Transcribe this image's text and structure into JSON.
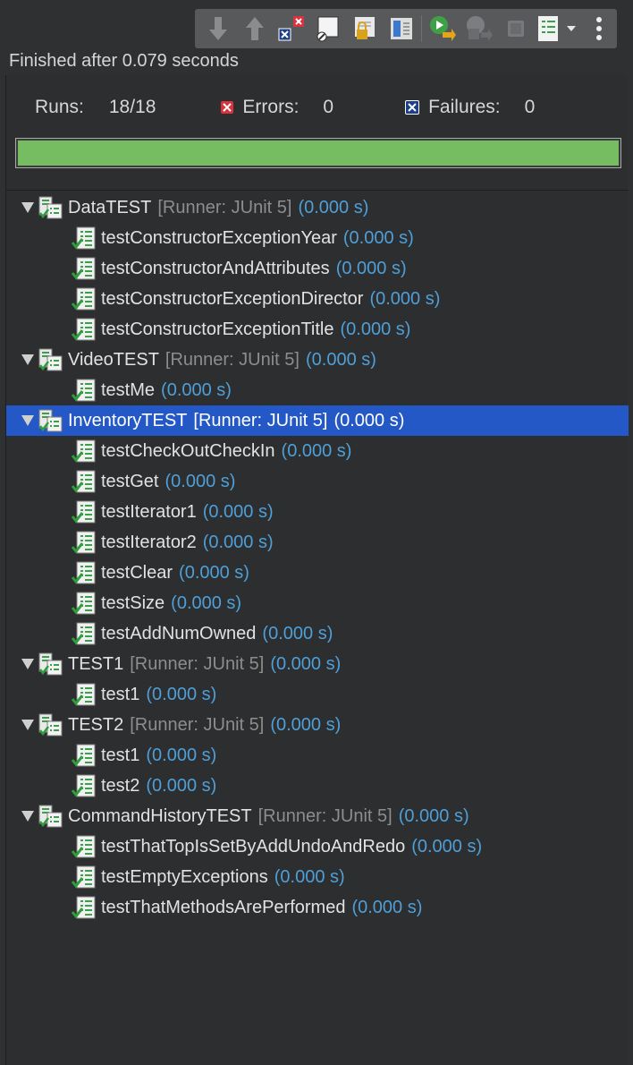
{
  "toolbar": {
    "buttons": [
      {
        "name": "next-failure-icon"
      },
      {
        "name": "previous-failure-icon"
      },
      {
        "name": "show-failures-only-icon"
      },
      {
        "name": "show-skipped-only-icon"
      },
      {
        "name": "scroll-lock-icon"
      },
      {
        "name": "layout-icon"
      },
      {
        "name": "rerun-test-icon"
      },
      {
        "name": "rerun-failed-first-icon"
      },
      {
        "name": "stop-icon"
      },
      {
        "name": "test-run-history-icon"
      },
      {
        "name": "view-menu-icon"
      }
    ]
  },
  "status": {
    "finished": "Finished after 0.079 seconds"
  },
  "stats": {
    "runs_label": "Runs:",
    "runs_value": "18/18",
    "errors_label": "Errors:",
    "errors_value": "0",
    "failures_label": "Failures:",
    "failures_value": "0"
  },
  "progress": {
    "fraction": 1.0,
    "color": "#76bd62"
  },
  "colors": {
    "selection": "#2458c6",
    "time": "#4f9fd8",
    "runner": "#8d8d8d"
  },
  "tree": [
    {
      "kind": "suite",
      "name": "DataTEST",
      "runner": "[Runner: JUnit 5]",
      "time": "(0.000 s)"
    },
    {
      "kind": "case",
      "name": "testConstructorExceptionYear",
      "time": "(0.000 s)"
    },
    {
      "kind": "case",
      "name": "testConstructorAndAttributes",
      "time": "(0.000 s)"
    },
    {
      "kind": "case",
      "name": "testConstructorExceptionDirector",
      "time": "(0.000 s)"
    },
    {
      "kind": "case",
      "name": "testConstructorExceptionTitle",
      "time": "(0.000 s)"
    },
    {
      "kind": "suite",
      "name": "VideoTEST",
      "runner": "[Runner: JUnit 5]",
      "time": "(0.000 s)"
    },
    {
      "kind": "case",
      "name": "testMe",
      "time": "(0.000 s)"
    },
    {
      "kind": "suite",
      "name": "InventoryTEST",
      "runner": "[Runner: JUnit 5]",
      "time": "(0.000 s)",
      "selected": true
    },
    {
      "kind": "case",
      "name": "testCheckOutCheckIn",
      "time": "(0.000 s)"
    },
    {
      "kind": "case",
      "name": "testGet",
      "time": "(0.000 s)"
    },
    {
      "kind": "case",
      "name": "testIterator1",
      "time": "(0.000 s)"
    },
    {
      "kind": "case",
      "name": "testIterator2",
      "time": "(0.000 s)"
    },
    {
      "kind": "case",
      "name": "testClear",
      "time": "(0.000 s)"
    },
    {
      "kind": "case",
      "name": "testSize",
      "time": "(0.000 s)"
    },
    {
      "kind": "case",
      "name": "testAddNumOwned",
      "time": "(0.000 s)"
    },
    {
      "kind": "suite",
      "name": "TEST1",
      "runner": "[Runner: JUnit 5]",
      "time": "(0.000 s)"
    },
    {
      "kind": "case",
      "name": "test1",
      "time": "(0.000 s)"
    },
    {
      "kind": "suite",
      "name": "TEST2",
      "runner": "[Runner: JUnit 5]",
      "time": "(0.000 s)"
    },
    {
      "kind": "case",
      "name": "test1",
      "time": "(0.000 s)"
    },
    {
      "kind": "case",
      "name": "test2",
      "time": "(0.000 s)"
    },
    {
      "kind": "suite",
      "name": "CommandHistoryTEST",
      "runner": "[Runner: JUnit 5]",
      "time": "(0.000 s)"
    },
    {
      "kind": "case",
      "name": "testThatTopIsSetByAddUndoAndRedo",
      "time": "(0.000 s)"
    },
    {
      "kind": "case",
      "name": "testEmptyExceptions",
      "time": "(0.000 s)"
    },
    {
      "kind": "case",
      "name": "testThatMethodsArePerformed",
      "time": "(0.000 s)"
    }
  ]
}
